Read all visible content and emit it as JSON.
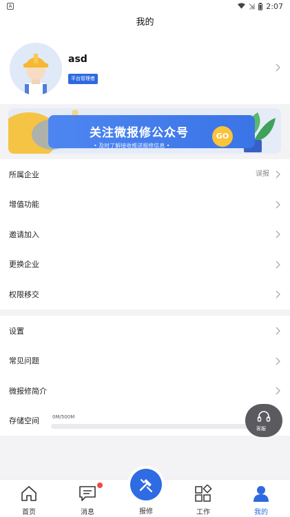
{
  "status_bar": {
    "time": "2:07",
    "app_letter": "A"
  },
  "header": {
    "title": "我的"
  },
  "profile": {
    "name": "asd",
    "role": "平台管理者"
  },
  "banner": {
    "title": "关注微报修公众号",
    "subtitle": "• 及时了解接收推送报修信息 •",
    "go": "GO"
  },
  "menu_group1": [
    {
      "label": "所属企业",
      "extra": "误报"
    },
    {
      "label": "增值功能",
      "extra": ""
    },
    {
      "label": "邀请加入",
      "extra": ""
    },
    {
      "label": "更换企业",
      "extra": ""
    },
    {
      "label": "权限移交",
      "extra": ""
    }
  ],
  "menu_group2": [
    {
      "label": "设置"
    },
    {
      "label": "常见问题"
    },
    {
      "label": "微报修简介"
    }
  ],
  "storage": {
    "label": "存储空间",
    "usage": "0M/500M",
    "fraction": 0.0
  },
  "support": {
    "label": "客服"
  },
  "tabs": {
    "home": "首页",
    "messages": "消息",
    "repair": "报修",
    "work": "工作",
    "mine": "我的"
  },
  "colors": {
    "accent": "#2d6ae0",
    "badge": "#f04848"
  }
}
